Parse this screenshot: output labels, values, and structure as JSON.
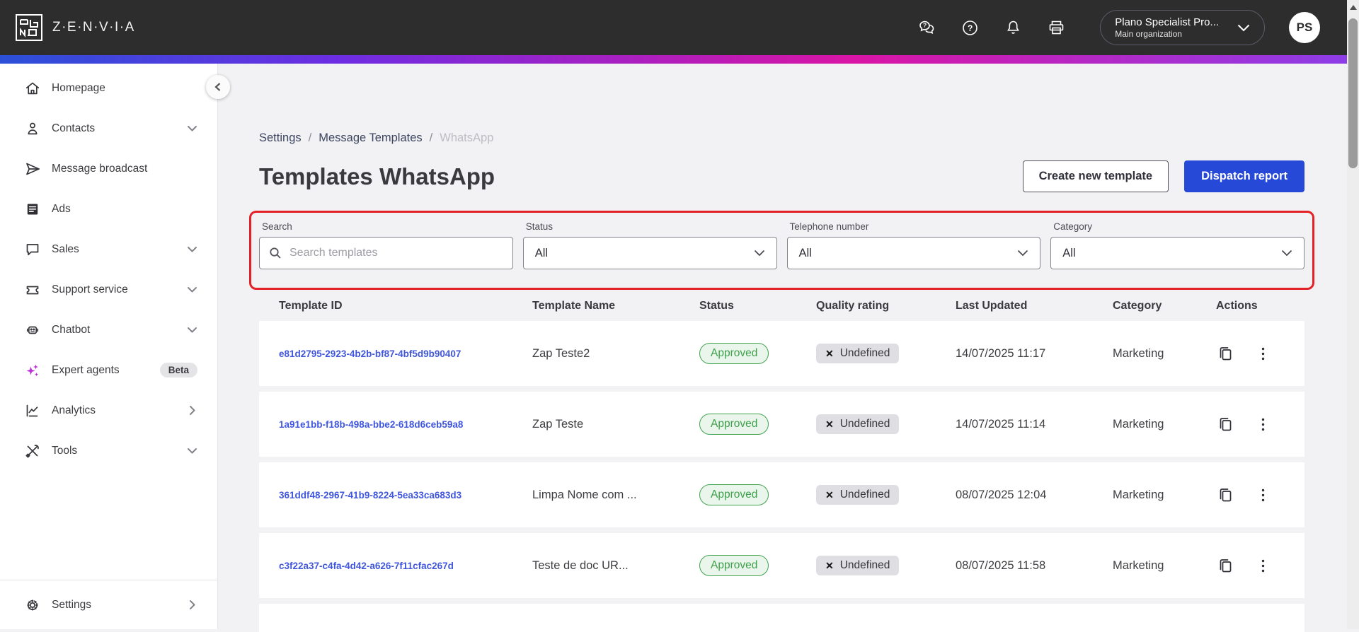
{
  "topbar": {
    "brand": "Z·E·N·V·I·A",
    "org": {
      "name": "Plano Specialist Pro...",
      "subtitle": "Main organization"
    },
    "avatar_initials": "PS"
  },
  "sidebar": {
    "items": [
      {
        "label": "Homepage",
        "icon": "home-icon"
      },
      {
        "label": "Contacts",
        "icon": "contacts-icon",
        "chevron": "down"
      },
      {
        "label": "Message broadcast",
        "icon": "send-icon"
      },
      {
        "label": "Ads",
        "icon": "ads-icon"
      },
      {
        "label": "Sales",
        "icon": "sales-chat-icon",
        "chevron": "down"
      },
      {
        "label": "Support service",
        "icon": "ticket-icon",
        "chevron": "down"
      },
      {
        "label": "Chatbot",
        "icon": "robot-icon",
        "chevron": "down"
      },
      {
        "label": "Expert agents",
        "icon": "sparkles-icon",
        "badge": "Beta"
      },
      {
        "label": "Analytics",
        "icon": "line-chart-icon",
        "chevron": "right"
      },
      {
        "label": "Tools",
        "icon": "tools-icon",
        "chevron": "down"
      }
    ],
    "settings": {
      "label": "Settings",
      "icon": "gear-icon",
      "chevron": "right"
    }
  },
  "breadcrumb": [
    "Settings",
    "Message Templates",
    "WhatsApp"
  ],
  "page": {
    "title": "Templates WhatsApp",
    "create_button": "Create new template",
    "dispatch_button": "Dispatch report"
  },
  "filters": {
    "search": {
      "label": "Search",
      "placeholder": "Search templates",
      "value": ""
    },
    "status": {
      "label": "Status",
      "value": "All"
    },
    "telephone": {
      "label": "Telephone number",
      "value": "All"
    },
    "category": {
      "label": "Category",
      "value": "All"
    }
  },
  "table": {
    "columns": [
      "Template ID",
      "Template Name",
      "Status",
      "Quality rating",
      "Last Updated",
      "Category",
      "Actions"
    ],
    "quality_x": "✕",
    "rows": [
      {
        "id": "e81d2795-2923-4b2b-bf87-4bf5d9b90407",
        "name": "Zap Teste2",
        "status": "Approved",
        "quality": "Undefined",
        "updated": "14/07/2025 11:17",
        "category": "Marketing"
      },
      {
        "id": "1a91e1bb-f18b-498a-bbe2-618d6ceb59a8",
        "name": "Zap Teste",
        "status": "Approved",
        "quality": "Undefined",
        "updated": "14/07/2025 11:14",
        "category": "Marketing"
      },
      {
        "id": "361ddf48-2967-41b9-8224-5ea33ca683d3",
        "name": "Limpa Nome com ...",
        "status": "Approved",
        "quality": "Undefined",
        "updated": "08/07/2025 12:04",
        "category": "Marketing"
      },
      {
        "id": "c3f22a37-c4fa-4d42-a626-7f11cfac267d",
        "name": "Teste de doc UR...",
        "status": "Approved",
        "quality": "Undefined",
        "updated": "08/07/2025 11:58",
        "category": "Marketing"
      }
    ]
  },
  "colors": {
    "topbar_dark": "#2d2d2d",
    "accent_blue": "#2749d8",
    "link_blue": "#3f56dd",
    "approved_green": "#3da04a",
    "annotation_red": "#e32227",
    "gradient": [
      "#2b50d8",
      "#6d2de2",
      "#d915a5",
      "#8b3ee8"
    ]
  }
}
